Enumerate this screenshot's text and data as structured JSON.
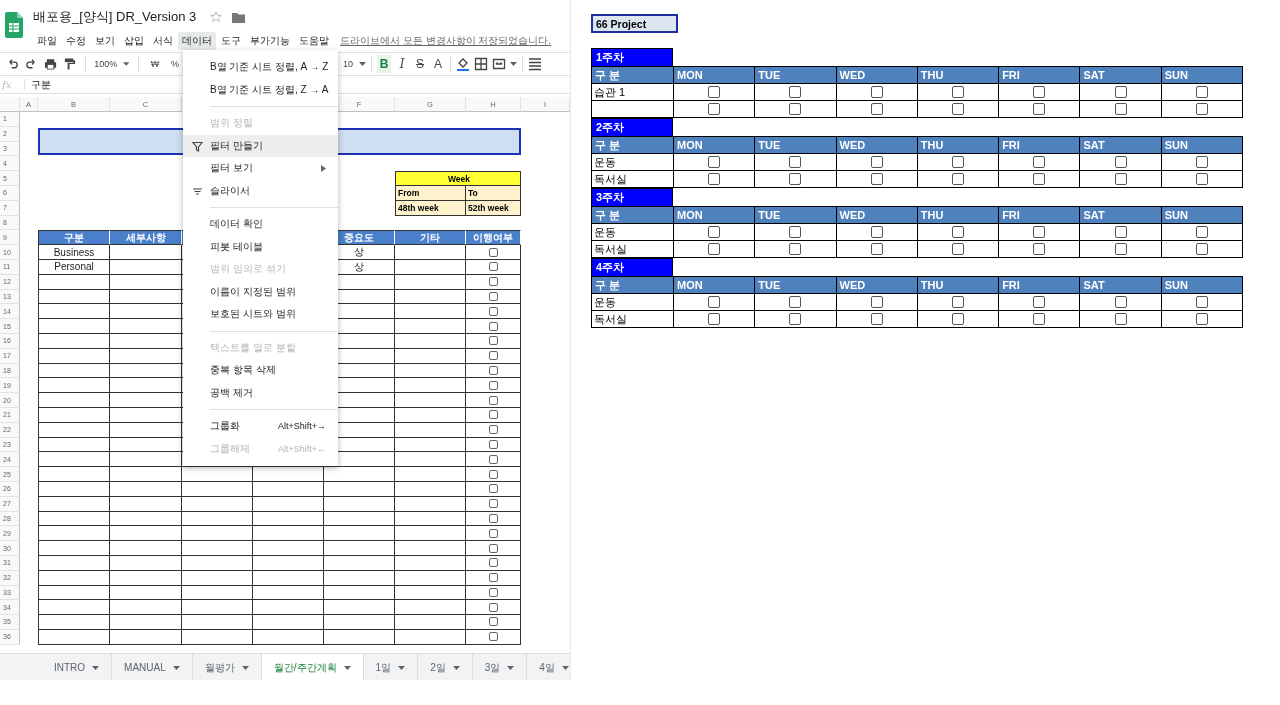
{
  "document": {
    "title": "배포용_[양식] DR_Version 3",
    "save_status": "드라이브에서 모든 변경사항이 저장되었습니다."
  },
  "menu": [
    {
      "label": "파일",
      "selected": false
    },
    {
      "label": "수정",
      "selected": false
    },
    {
      "label": "보기",
      "selected": false
    },
    {
      "label": "삽입",
      "selected": false
    },
    {
      "label": "서식",
      "selected": false
    },
    {
      "label": "데이터",
      "selected": true
    },
    {
      "label": "도구",
      "selected": false
    },
    {
      "label": "부가기능",
      "selected": false
    },
    {
      "label": "도움말",
      "selected": false
    }
  ],
  "toolbar": {
    "zoom": "100%",
    "currency": "₩",
    "percent": "%",
    "font_size": "10",
    "bold": {
      "label": "B",
      "selected": true
    },
    "italic": "I",
    "strike": "S",
    "text_color": "A"
  },
  "formula_bar": {
    "label": "fx",
    "value": "구분"
  },
  "sheet": {
    "columns": [
      "A",
      "B",
      "C",
      "F",
      "G",
      "H",
      "I"
    ],
    "row_numbers": [
      "1",
      "2",
      "3",
      "4",
      "5",
      "6",
      "7",
      "8",
      "9",
      "10",
      "11",
      "12",
      "13",
      "14",
      "15",
      "16",
      "17",
      "18",
      "19",
      "20",
      "21",
      "22",
      "23",
      "24",
      "25",
      "26",
      "27",
      "28",
      "29",
      "30",
      "31",
      "32",
      "33",
      "34",
      "35",
      "36"
    ],
    "week_box": {
      "title": "Week",
      "from_label": "From",
      "to_label": "To",
      "from": "48th week",
      "to": "52th week"
    },
    "header": [
      "구분",
      "세부사항",
      "중요도",
      "기타",
      "이행여부"
    ],
    "rows": [
      {
        "category": "Business",
        "importance": "상",
        "checked": false
      },
      {
        "category": "Personal",
        "importance": "상",
        "checked": false
      },
      {
        "checked": false
      },
      {
        "checked": false
      },
      {
        "checked": false
      },
      {
        "checked": false
      },
      {
        "checked": false
      },
      {
        "checked": false
      },
      {
        "checked": false
      },
      {
        "checked": false
      },
      {
        "checked": false
      },
      {
        "checked": false
      },
      {
        "checked": false
      },
      {
        "checked": false
      },
      {
        "checked": false
      },
      {
        "checked": false
      },
      {
        "checked": false
      },
      {
        "checked": false
      },
      {
        "checked": false
      },
      {
        "checked": false
      },
      {
        "checked": false
      },
      {
        "checked": false
      },
      {
        "checked": false
      },
      {
        "checked": false
      },
      {
        "checked": false
      },
      {
        "checked": false
      },
      {
        "checked": false
      }
    ]
  },
  "data_menu": [
    {
      "kind": "plain",
      "label": "B열 기준 시트 정렬, A → Z",
      "disabled": false,
      "highlighted": false
    },
    {
      "kind": "plain",
      "label": "B열 기준 시트 정렬, Z → A",
      "disabled": false,
      "highlighted": false
    },
    {
      "kind": "separator"
    },
    {
      "kind": "plain",
      "label": "범위 정렬",
      "disabled": true,
      "highlighted": false
    },
    {
      "kind": "filter",
      "label": "필터 만들기",
      "disabled": false,
      "highlighted": true
    },
    {
      "kind": "submenu",
      "label": "필터 보기",
      "disabled": false,
      "highlighted": false
    },
    {
      "kind": "slicer",
      "label": "슬라이서",
      "disabled": false,
      "highlighted": false
    },
    {
      "kind": "separator"
    },
    {
      "kind": "plain",
      "label": "데이터 확인",
      "disabled": false,
      "highlighted": false
    },
    {
      "kind": "plain",
      "label": "피봇 테이블",
      "disabled": false,
      "highlighted": false
    },
    {
      "kind": "plain",
      "label": "범위 임의로 섞기",
      "disabled": true,
      "highlighted": false
    },
    {
      "kind": "plain",
      "label": "이름이 지정된 범위",
      "disabled": false,
      "highlighted": false
    },
    {
      "kind": "plain",
      "label": "보호된 시트와 범위",
      "disabled": false,
      "highlighted": false
    },
    {
      "kind": "separator"
    },
    {
      "kind": "plain",
      "label": "텍스트를 열로 분할",
      "disabled": true,
      "highlighted": false
    },
    {
      "kind": "plain",
      "label": "중복 항목 삭제",
      "disabled": false,
      "highlighted": false
    },
    {
      "kind": "plain",
      "label": "공백 제거",
      "disabled": false,
      "highlighted": false
    },
    {
      "kind": "separator"
    },
    {
      "kind": "plain",
      "label": "그룹화",
      "shortcut": "Alt+Shift+→",
      "disabled": false,
      "highlighted": false
    },
    {
      "kind": "plain",
      "label": "그룹해제",
      "shortcut": "Alt+Shift+←",
      "disabled": true,
      "highlighted": false
    }
  ],
  "sheet_tabs": [
    {
      "label": "INTRO",
      "selected": false
    },
    {
      "label": "MANUAL",
      "selected": false
    },
    {
      "label": "월평가",
      "selected": false
    },
    {
      "label": "월간/주간계획",
      "selected": true
    },
    {
      "label": "1일",
      "selected": false
    },
    {
      "label": "2일",
      "selected": false
    },
    {
      "label": "3일",
      "selected": false
    },
    {
      "label": "4일",
      "selected": false
    }
  ],
  "project": {
    "title": "66 Project",
    "weeks": [
      {
        "label": "1주차",
        "header": [
          "구 분",
          "MON",
          "TUE",
          "WED",
          "THU",
          "FRI",
          "SAT",
          "SUN"
        ],
        "rows": [
          {
            "label": "습관 1",
            "checks": [
              false,
              false,
              false,
              false,
              false,
              false,
              false
            ]
          },
          {
            "checks": [
              false,
              false,
              false,
              false,
              false,
              false,
              false
            ]
          }
        ]
      },
      {
        "label": "2주차",
        "header": [
          "구 분",
          "MON",
          "TUE",
          "WED",
          "THU",
          "FRI",
          "SAT",
          "SUN"
        ],
        "rows": [
          {
            "label": "운동",
            "checks": [
              false,
              false,
              false,
              false,
              false,
              false,
              false
            ]
          },
          {
            "label": "독서실",
            "checks": [
              false,
              false,
              false,
              false,
              false,
              false,
              false
            ]
          }
        ]
      },
      {
        "label": "3주차",
        "header": [
          "구 분",
          "MON",
          "TUE",
          "WED",
          "THU",
          "FRI",
          "SAT",
          "SUN"
        ],
        "rows": [
          {
            "label": "운동",
            "checks": [
              false,
              false,
              false,
              false,
              false,
              false,
              false
            ]
          },
          {
            "label": "독서실",
            "checks": [
              false,
              false,
              false,
              false,
              false,
              false,
              false
            ]
          }
        ]
      },
      {
        "label": "4주차",
        "header": [
          "구 분",
          "MON",
          "TUE",
          "WED",
          "THU",
          "FRI",
          "SAT",
          "SUN"
        ],
        "rows": [
          {
            "label": "운동",
            "checks": [
              false,
              false,
              false,
              false,
              false,
              false,
              false
            ]
          },
          {
            "label": "독서실",
            "checks": [
              false,
              false,
              false,
              false,
              false,
              false,
              false
            ]
          }
        ]
      }
    ]
  }
}
